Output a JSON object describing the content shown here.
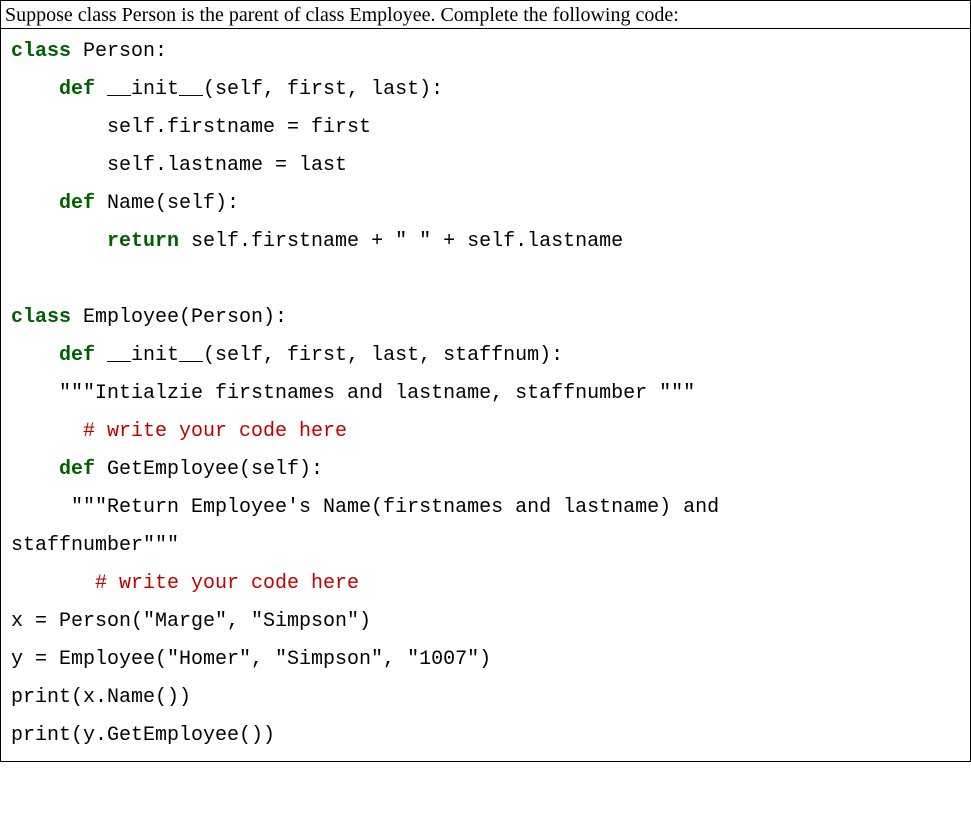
{
  "prompt": "Suppose class Person is the parent of class Employee. Complete the following code:",
  "code": {
    "kw_class1": "class",
    "pname": " Person:",
    "kw_def1": "    def",
    "init1": " __init__(self, first, last):",
    "line_first": "        self.firstname = first",
    "line_last": "        self.lastname = last",
    "kw_def2": "    def",
    "name_sig": " Name(self):",
    "kw_return1": "        return",
    "name_body": " self.firstname + \" \" + self.lastname",
    "kw_class2": "class",
    "ename": " Employee(Person):",
    "kw_def3": "    def",
    "init2": " __init__(self, first, last, staffnum):",
    "doc1": "    \"\"\"Intialzie firstnames and lastname, staffnumber \"\"\"",
    "comment1": "      # write your code here",
    "kw_def4": "    def",
    "getemp_sig": " GetEmployee(self):",
    "doc2a": "     \"\"\"Return Employee's Name(firstnames and lastname) and ",
    "doc2b": "staffnumber\"\"\"",
    "comment2": "       # write your code here",
    "assign_x": "x = Person(\"Marge\", \"Simpson\")",
    "assign_y": "y = Employee(\"Homer\", \"Simpson\", \"1007\")",
    "print_x": "print(x.Name())",
    "print_y": "print(y.GetEmployee())"
  }
}
